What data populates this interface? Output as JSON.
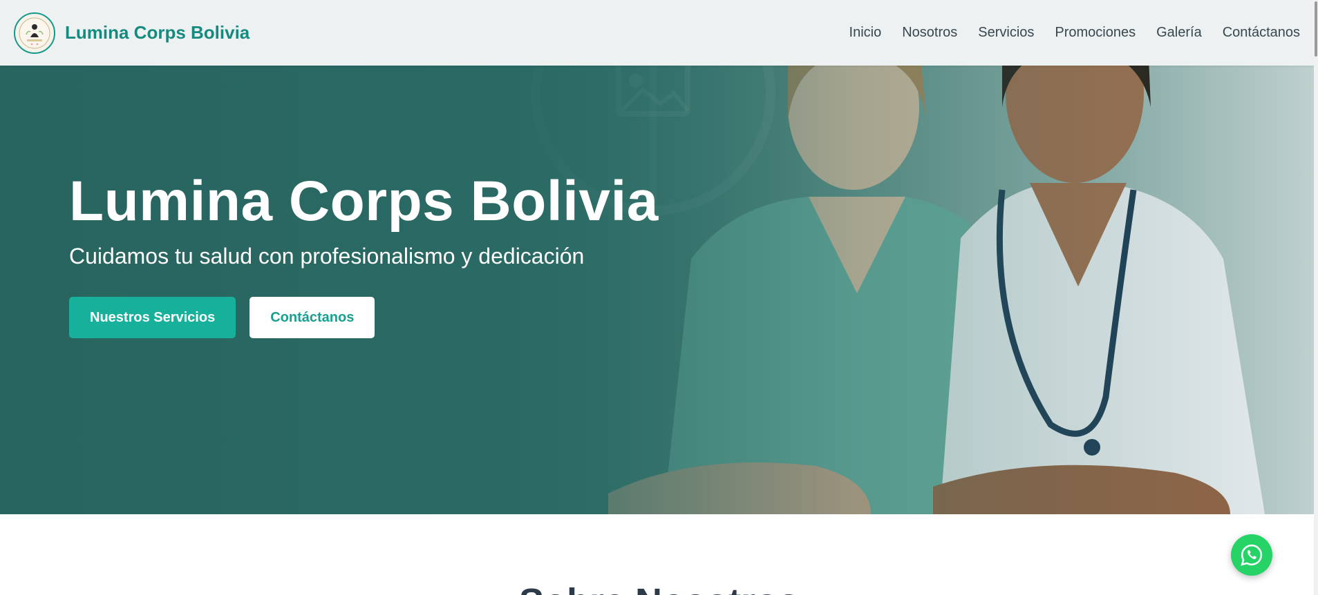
{
  "header": {
    "brand_name": "Lumina Corps Bolivia",
    "logo_text": "LUMINA CORPS",
    "nav": [
      {
        "label": "Inicio"
      },
      {
        "label": "Nosotros"
      },
      {
        "label": "Servicios"
      },
      {
        "label": "Promociones"
      },
      {
        "label": "Galería"
      },
      {
        "label": "Contáctanos"
      }
    ]
  },
  "hero": {
    "title": "Lumina Corps Bolivia",
    "subtitle": "Cuidamos tu salud con profesionalismo y dedicación",
    "primary_button": "Nuestros Servicios",
    "secondary_button": "Contáctanos"
  },
  "next_section": {
    "title": "Sobre Nosotros"
  },
  "floating": {
    "whatsapp_icon": "whatsapp-icon"
  },
  "colors": {
    "brand_teal": "#158a7e",
    "button_primary": "#17b09b",
    "hero_overlay": "#2d6b66",
    "whatsapp": "#25d366"
  }
}
